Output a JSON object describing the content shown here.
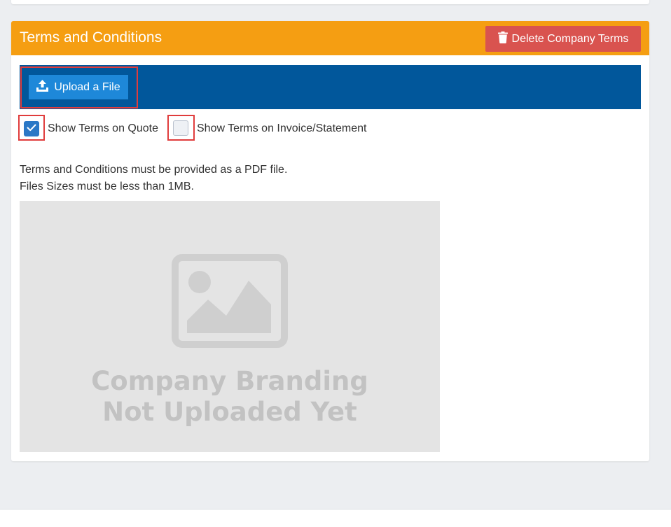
{
  "panel": {
    "title": "Terms and Conditions",
    "delete_label": "Delete Company Terms",
    "delete_icon": "trash-icon",
    "header_color": "#f59e12",
    "delete_color": "#d9534f"
  },
  "upload": {
    "label": "Upload a File",
    "icon": "upload-icon",
    "bar_color": "#01579b",
    "button_color": "#1e88d9"
  },
  "options": {
    "quote": {
      "label": "Show Terms on Quote",
      "checked": true
    },
    "invoice": {
      "label": "Show Terms on Invoice/Statement",
      "checked": false
    }
  },
  "info": {
    "line1": "Terms and Conditions must be provided as a PDF file.",
    "line2": "Files Sizes must be less than 1MB."
  },
  "placeholder": {
    "line1": "Company Branding",
    "line2": "Not Uploaded Yet",
    "icon": "image-placeholder-icon"
  },
  "colors": {
    "highlight": "#e03c3c",
    "checkbox_checked": "#2b78c6"
  }
}
